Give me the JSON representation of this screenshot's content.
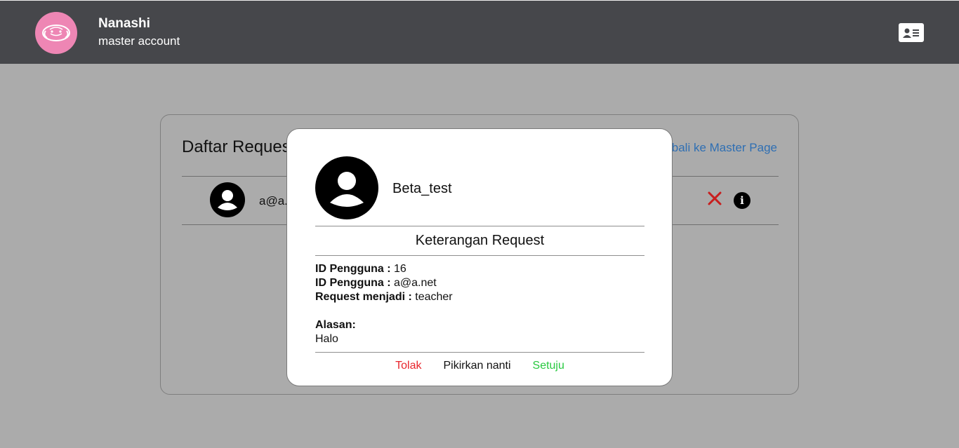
{
  "header": {
    "user_name": "Nanashi",
    "user_role": "master account",
    "logo_icon": "elephant-logo-icon",
    "profile_icon": "contact-card-icon"
  },
  "card": {
    "title": "Daftar Request",
    "back_link": "Kembali ke Master Page",
    "rows": [
      {
        "email": "a@a.net",
        "avatar_icon": "user-avatar-icon",
        "reject_icon": "close-icon",
        "info_icon": "info-icon"
      }
    ]
  },
  "modal": {
    "username": "Beta_test",
    "section_title": "Keterangan Request",
    "details": [
      {
        "label": "ID Pengguna :",
        "value": "16"
      },
      {
        "label": "ID Pengguna :",
        "value": "a@a.net"
      },
      {
        "label": "Request menjadi :",
        "value": "teacher"
      }
    ],
    "reason_label": "Alasan:",
    "reason_value": "Halo",
    "actions": {
      "reject": "Tolak",
      "later": "Pikirkan nanti",
      "approve": "Setuju"
    }
  },
  "colors": {
    "topbar": "#46474b",
    "logo_bg": "#ee86b4",
    "overlay_bg": "#ababab",
    "link": "#2f6fb3",
    "reject": "#e8252c",
    "approve": "#27c93f"
  }
}
